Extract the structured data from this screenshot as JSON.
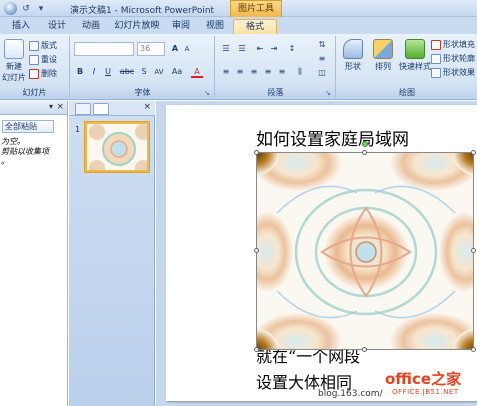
{
  "window": {
    "title": "演示文稿1 - Microsoft PowerPoint",
    "context_tab_group": "图片工具"
  },
  "quick_access": {
    "icons": [
      "office-button-icon",
      "undo-icon",
      "dropdown-icon"
    ],
    "undo_glyph": "↺",
    "dropdown_glyph": "▾"
  },
  "ribbon_tabs": [
    "插入",
    "设计",
    "动画",
    "幻灯片放映",
    "审阅",
    "视图",
    "格式"
  ],
  "ribbon": {
    "slides_group": {
      "label": "幻灯片",
      "new_slide": "新建\n幻灯片",
      "layout": "版式",
      "reset": "重设",
      "delete": "删除"
    },
    "font_group": {
      "label": "字体",
      "font_size": "36",
      "grow": "A",
      "shrink": "A",
      "bold": "B",
      "italic": "I",
      "underline": "U",
      "strike": "abc",
      "shadow": "S",
      "spacing": "AV",
      "case": "Aa",
      "color": "A"
    },
    "paragraph_group": {
      "label": "段落"
    },
    "drawing_group": {
      "label": "绘图",
      "shapes": "形状",
      "arrange": "排列",
      "quick_styles": "快速样式",
      "shape_fill": "形状填充",
      "shape_outline": "形状轮廓",
      "shape_effects": "形状效果"
    }
  },
  "outline_pane": {
    "clip_all": "全部粘贴",
    "text_lines": [
      "为空。",
      "剪贴以收集项",
      "。"
    ],
    "close": "×",
    "arrow": "▾"
  },
  "slides_pane": {
    "close": "×",
    "slide_number": "1"
  },
  "slide": {
    "title": "如何设置家庭局域网",
    "body_line1": "就在“一个网段",
    "body_line2": "设置大体相同"
  },
  "watermark": {
    "blog": "blog.163.com/",
    "logo": "office之家",
    "domain": "OFFICE.JB51.NET"
  },
  "colors": {
    "ribbon_bg": "#d6e4f4",
    "context_tab": "#f1b84a",
    "thumb_border": "#f2b649",
    "watermark": "#e8401c"
  }
}
